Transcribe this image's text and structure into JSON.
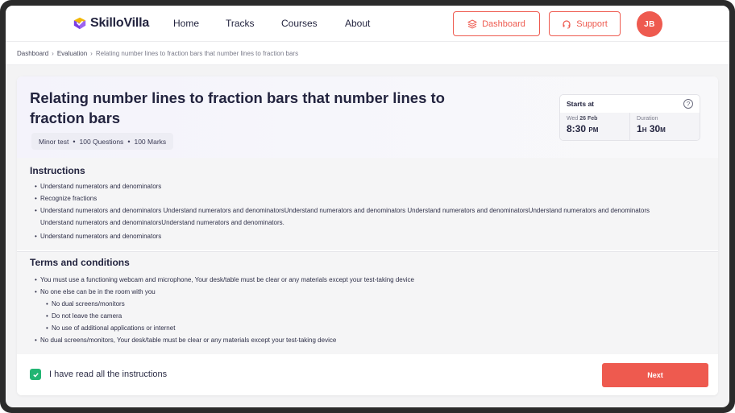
{
  "brand": {
    "name": "SkilloVilla",
    "accent": "#ee5a4f",
    "logo_colors": [
      "#7b3fe4",
      "#f2b705"
    ]
  },
  "nav": {
    "links": [
      "Home",
      "Tracks",
      "Courses",
      "About"
    ],
    "dashboard_label": "Dashboard",
    "dashboard_icon": "layers-icon",
    "support_label": "Support",
    "support_icon": "headset-icon",
    "avatar_initials": "JB"
  },
  "breadcrumb": {
    "items": [
      "Dashboard",
      "Evaluation",
      "Relating number lines to fraction bars that number lines to fraction bars"
    ]
  },
  "exam": {
    "title": "Relating number lines to fraction bars that number lines to fraction bars",
    "type": "Minor test",
    "questions": "100 Questions",
    "marks": "100 Marks"
  },
  "schedule": {
    "label": "Starts at",
    "day": "Wed",
    "date": "26 Feb",
    "time": "8:30",
    "ampm": "PM",
    "duration_label": "Duration",
    "duration_h": "1",
    "duration_h_unit": "H",
    "duration_m": "30",
    "duration_m_unit": "M"
  },
  "instructions": {
    "title": "Instructions",
    "items": [
      "Understand numerators and denominators",
      "Recognize fractions",
      "Understand numerators and denominators Understand numerators and denominatorsUnderstand numerators and denominators Understand numerators and denominatorsUnderstand numerators and denominators Understand numerators and denominatorsUnderstand numerators and denominators.",
      "Understand numerators and denominators"
    ]
  },
  "terms": {
    "title": "Terms and conditions",
    "items": [
      "You must use a functioning webcam and microphone, Your desk/table must be clear or any materials except your test-taking device",
      "No one else can be in the room with you",
      "No dual screens/monitors",
      "Do not leave the camera",
      "No use of additional applications or internet",
      "No dual screens/monitors, Your desk/table must be clear or any materials except your test-taking device"
    ]
  },
  "footer": {
    "checkbox_label": "I have read all the instructions",
    "checked": true,
    "next_label": "Next"
  }
}
